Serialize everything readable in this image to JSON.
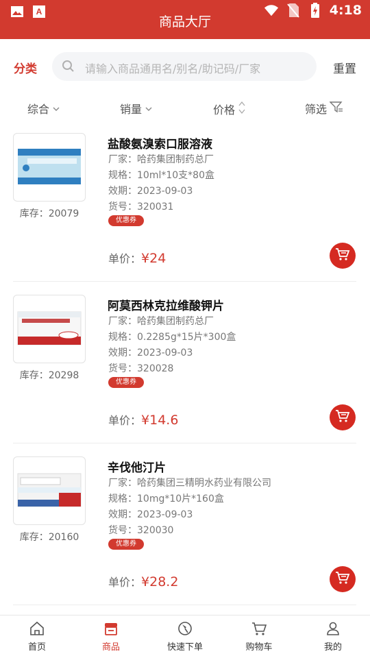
{
  "status": {
    "time": "4:18"
  },
  "header": {
    "title": "商品大厅"
  },
  "search": {
    "category_label": "分类",
    "placeholder": "请输入商品通用名/别名/助记码/厂家",
    "reset_label": "重置"
  },
  "sort": {
    "items": [
      "综合",
      "销量",
      "价格",
      "筛选"
    ]
  },
  "products": [
    {
      "name": "盐酸氨溴索口服溶液",
      "maker": "厂家：哈药集团制药总厂",
      "spec": "规格：10ml*10支*80盒",
      "expiry": "效期：2023-09-03",
      "code": "货号：320031",
      "coupon": "优惠券",
      "stock": "库存：20079",
      "price_label": "单价：",
      "price": "¥24"
    },
    {
      "name": "阿莫西林克拉维酸钾片",
      "maker": "厂家：哈药集团制药总厂",
      "spec": "规格：0.2285g*15片*300盒",
      "expiry": "效期：2023-09-03",
      "code": "货号：320028",
      "coupon": "优惠券",
      "stock": "库存：20298",
      "price_label": "单价：",
      "price": "¥14.6"
    },
    {
      "name": "辛伐他汀片",
      "maker": "厂家：哈药集团三精明水药业有限公司",
      "spec": "规格：10mg*10片*160盒",
      "expiry": "效期：2023-09-03",
      "code": "货号：320030",
      "coupon": "优惠券",
      "stock": "库存：20160",
      "price_label": "单价：",
      "price": "¥28.2"
    }
  ],
  "tabs": [
    {
      "label": "首页",
      "icon": "home-icon"
    },
    {
      "label": "商品",
      "icon": "store-icon"
    },
    {
      "label": "快速下单",
      "icon": "quick-order-icon"
    },
    {
      "label": "购物车",
      "icon": "cart-icon"
    },
    {
      "label": "我的",
      "icon": "user-icon"
    }
  ],
  "colors": {
    "brand": "#d23a2f",
    "cart_button": "#d52a21"
  }
}
